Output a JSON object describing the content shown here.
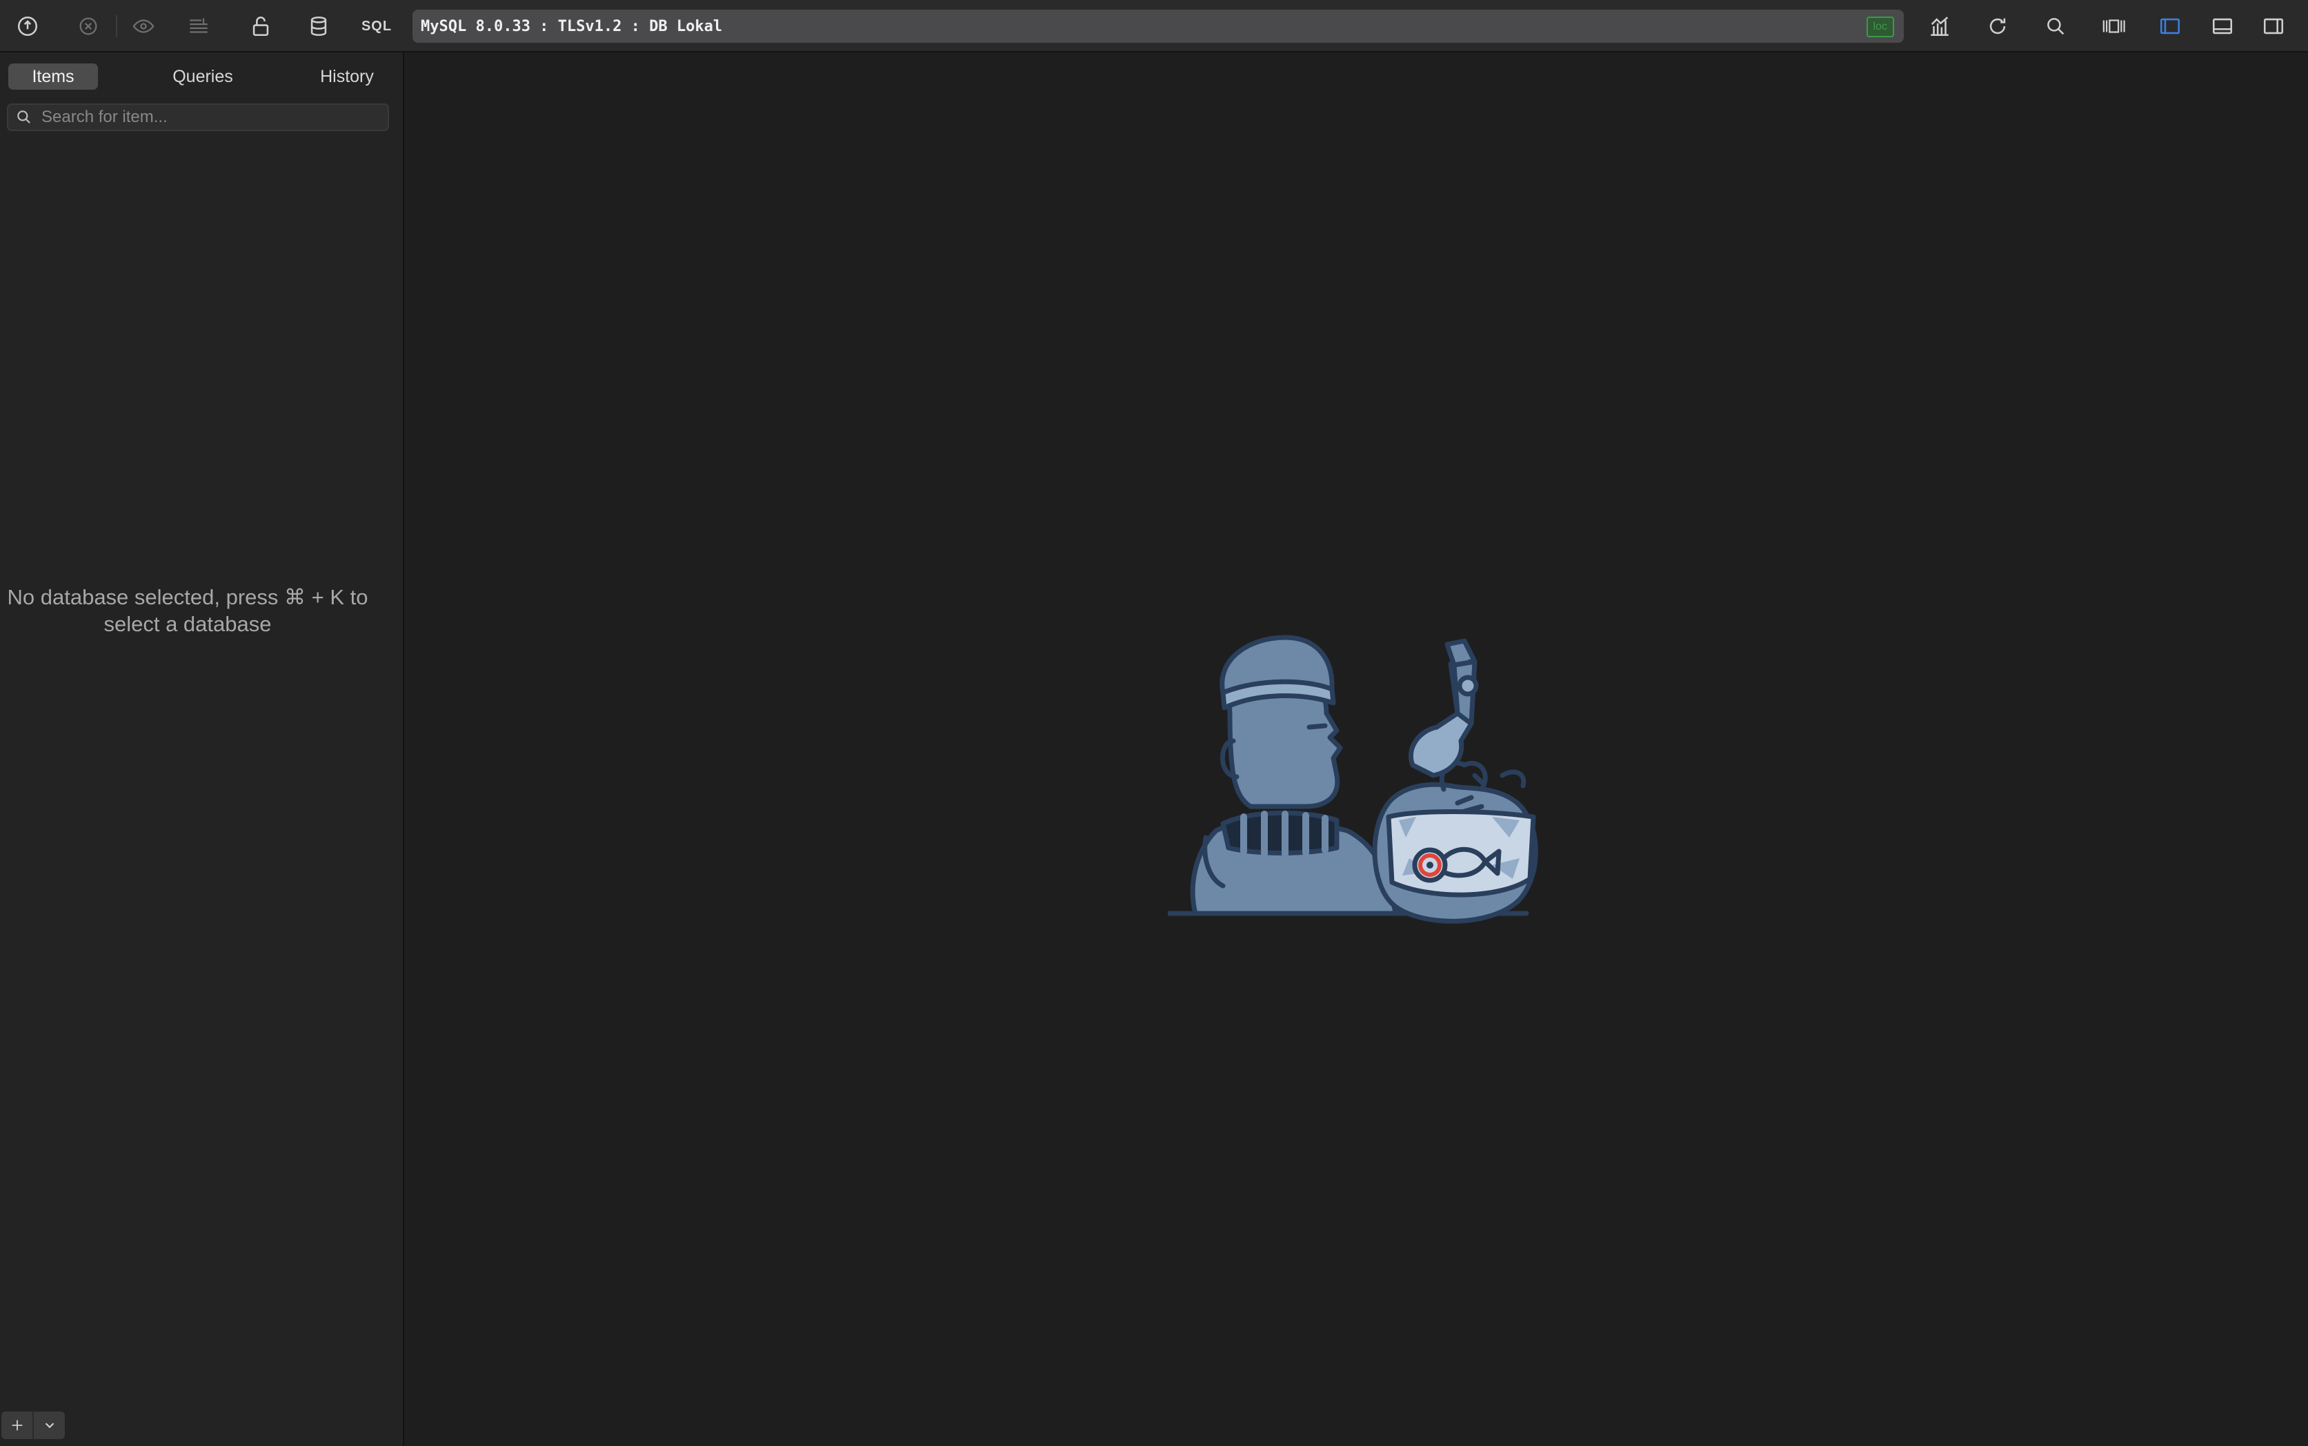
{
  "toolbar": {
    "buttons": [
      {
        "name": "connection-icon"
      },
      {
        "name": "close-icon"
      },
      {
        "name": "eye-icon"
      },
      {
        "name": "filter-list-icon"
      },
      {
        "name": "lock-icon"
      },
      {
        "name": "database-icon"
      },
      {
        "name": "sql-label"
      }
    ],
    "sql_label": "SQL",
    "connection_text": "MySQL 8.0.33 : TLSv1.2 : DB Lokal",
    "connection_tag": "loc",
    "right_buttons": [
      "chart-icon",
      "refresh-icon",
      "search-icon",
      "toggle-columns-icon",
      "left-panel-icon",
      "bottom-panel-icon",
      "right-panel-icon"
    ]
  },
  "sidebar": {
    "tabs": [
      {
        "label": "Items",
        "selected": true
      },
      {
        "label": "Queries",
        "selected": false
      },
      {
        "label": "History",
        "selected": false
      }
    ],
    "search_placeholder": "Search for item...",
    "empty_message": "No database selected, press ⌘ + K to select a database",
    "add_button": "+",
    "dropdown_button": "chevron-down-icon"
  },
  "colors": {
    "background": "#1e1e1e",
    "sidebar": "#232323",
    "toolbar": "#2a2a2a",
    "accent": "#3d7fe0",
    "tag_green": "#3a9a4a",
    "illustration_blue": "#6e89a8"
  }
}
